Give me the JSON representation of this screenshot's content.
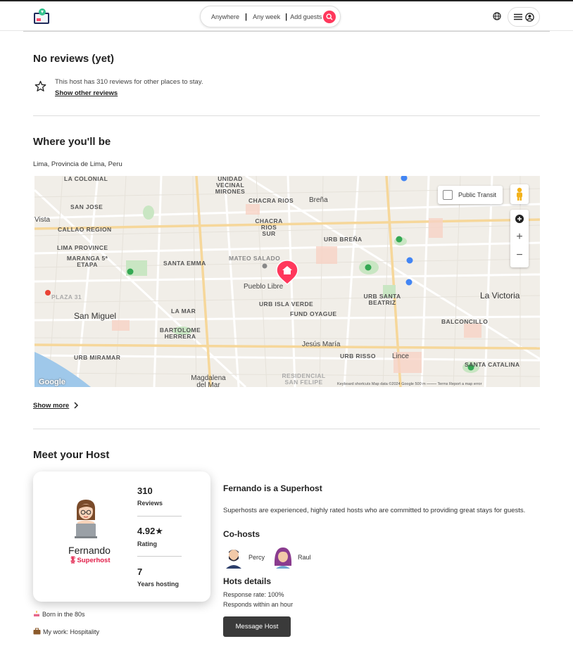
{
  "header": {
    "search": {
      "where": "Anywhere",
      "when": "Any week",
      "who": "Add guests"
    }
  },
  "reviews": {
    "title": "No reviews (yet)",
    "text": "This host has 310 reviews for other places to stay.",
    "link": "Show other reviews"
  },
  "location": {
    "title": "Where you'll be",
    "address": "Lima, Provincia de Lima, Peru",
    "map": {
      "public_transit": "Public Transit",
      "labels": [
        "LA COLONIAL",
        "UNIDAD VECINAL MIRONES",
        "CHACRA RIOS",
        "Breña",
        "SAN JOSE",
        "Vista",
        "CALLAO REGION",
        "CHACRA RIOS SUR",
        "URB BREÑA",
        "LIMA PROVINCE",
        "MARANGA 5ª ETAPA",
        "SANTA EMMA",
        "MATEO SALADO",
        "Pueblo Libre",
        "URB SANTA BEATRIZ",
        "La Victoria",
        "PLAZA 31",
        "URB ISLA VERDE",
        "FUND OYAGUE",
        "San Miguel",
        "LA MAR",
        "BALCONCILLO",
        "BARTOLOME HERRERA",
        "Jesús María",
        "URB MIRAMAR",
        "URB RISSO",
        "Lince",
        "SANTA CATALINA",
        "Magdalena del Mar",
        "RESIDENCIAL SAN FELIPE"
      ],
      "google": "Google",
      "footer": "Keyboard shortcuts     Map data ©2024 Google     500 m ⎯⎯⎯⎯⎯     Terms     Report a map error"
    },
    "show_more": "Show more"
  },
  "host": {
    "title": "Meet your Host",
    "name": "Fernando",
    "badge": "Superhost",
    "stats": [
      {
        "value": "310",
        "label": "Reviews"
      },
      {
        "value": "4.92★",
        "label": "Rating"
      },
      {
        "value": "7",
        "label": "Years hosting"
      }
    ],
    "superhost_title": "Fernando is a Superhost",
    "superhost_desc": "Superhosts are experienced, highly rated hosts who are committed to providing great stays for guests.",
    "cohosts_title": "Co-hosts",
    "cohosts": [
      "Percy",
      "Raul"
    ],
    "details_title": "Hots details",
    "response_rate": "Response rate: 100%",
    "response_time": "Responds within an hour",
    "message_button": "Message Host",
    "facts": [
      "Born in the 80s",
      "My work: Hospitality"
    ]
  },
  "colors": {
    "brand": "#ff385c",
    "superhost": "#e11d48",
    "button": "#3a3a3a"
  }
}
